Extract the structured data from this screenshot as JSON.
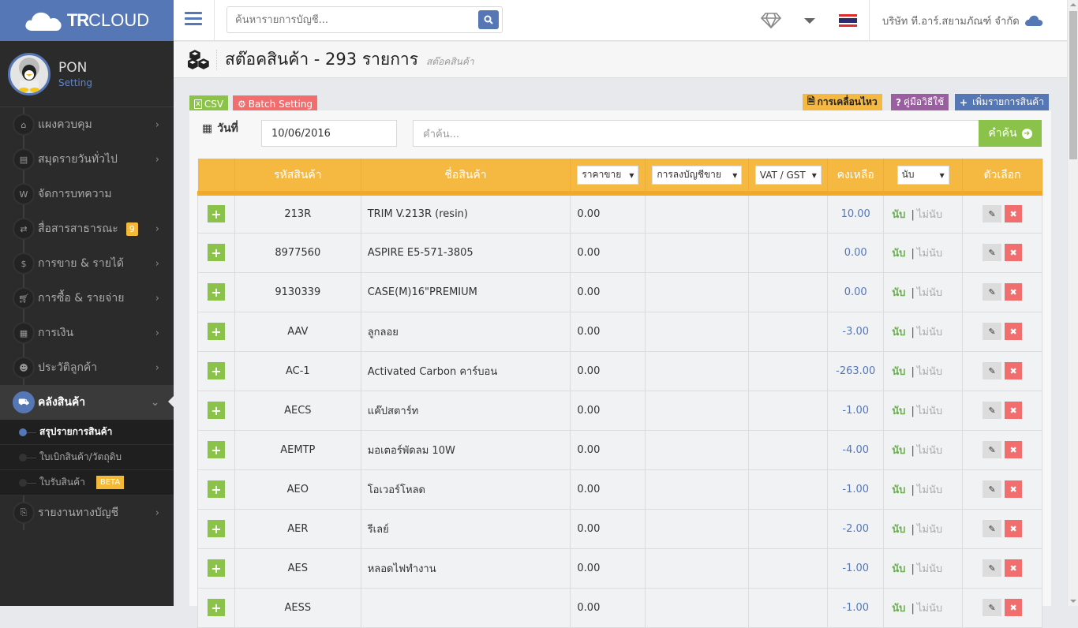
{
  "brand": {
    "bold": "TR",
    "light": "CLOUD"
  },
  "profile": {
    "name": "PON",
    "link": "Setting"
  },
  "sidebar": {
    "items": [
      {
        "label": "แผงควบคุม",
        "icon": "home-icon",
        "glyph": "⌂"
      },
      {
        "label": "สมุดรายวันทั่วไป",
        "icon": "book-icon",
        "glyph": "▤"
      },
      {
        "label": "จัดการบทความ",
        "icon": "wordpress-icon",
        "glyph": "W"
      },
      {
        "label": "สื่อสารสาธารณะ",
        "icon": "exchange-icon",
        "glyph": "⇄",
        "badge": "9"
      },
      {
        "label": "การขาย & รายได้",
        "icon": "dollar-icon",
        "glyph": "$"
      },
      {
        "label": "การซื้อ & รายจ่าย",
        "icon": "cart-icon",
        "glyph": "⛟"
      },
      {
        "label": "การเงิน",
        "icon": "calendar-icon",
        "glyph": "▦"
      },
      {
        "label": "ประวัติลูกค้า",
        "icon": "users-icon",
        "glyph": "☻"
      },
      {
        "label": "คลังสินค้า",
        "icon": "truck-icon",
        "glyph": "⛟"
      }
    ],
    "subitems": [
      {
        "label": "สรุปรายการสินค้า"
      },
      {
        "label": "ใบเบิกสินค้า/วัตถุดิบ"
      },
      {
        "label": "ใบรับสินค้า",
        "badge": "BETA"
      }
    ],
    "last": {
      "label": "รายงานทางบัญชี",
      "icon": "report-icon",
      "glyph": "⎘"
    }
  },
  "topbar": {
    "search_placeholder": "ค้นหารายการบัญชี...",
    "company": "บริษัท ที.อาร์.สยามภัณฑ์ จำกัด"
  },
  "page": {
    "title": "สต๊อคสินค้า - 293 รายการ",
    "subtitle": "สต๊อคสินค้า"
  },
  "toolbar": {
    "csv": "CSV",
    "batch": "Batch Setting",
    "movement": "การเคลื่อนไหว",
    "manual": "คู่มือวิธีใช้",
    "add": "เพิ่มรายการสินค้า"
  },
  "filter": {
    "date_label": "วันที่",
    "date_value": "10/06/2016",
    "query_placeholder": "คำค้น...",
    "search_button": "คำค้น"
  },
  "colors": {
    "primary": "#5577b5",
    "green": "#8bc34a",
    "orange": "#f5b942",
    "red": "#f06e6e",
    "purple": "#9b5ea0"
  },
  "table": {
    "headers": {
      "code": "รหัสสินค้า",
      "name": "ชื่อสินค้า",
      "price": "ราคาขาย",
      "account": "การลงบัญชีขาย",
      "vat": "VAT / GST",
      "balance": "คงเหลือ",
      "count": "นับ",
      "options": "ตัวเลือก"
    },
    "count_label": "นับ",
    "nocount_label": "ไม่นับ",
    "rows": [
      {
        "code": "213R",
        "name": "TRIM V.213R (resin)",
        "price": "0.00",
        "balance": "10.00"
      },
      {
        "code": "8977560",
        "name": "ASPIRE E5-571-3805",
        "price": "0.00",
        "balance": "0.00"
      },
      {
        "code": "9130339",
        "name": "CASE(M)16\"PREMIUM",
        "price": "0.00",
        "balance": "0.00"
      },
      {
        "code": "AAV",
        "name": "ลูกลอย",
        "price": "0.00",
        "balance": "-3.00"
      },
      {
        "code": "AC-1",
        "name": "Activated Carbon คาร์บอน",
        "price": "0.00",
        "balance": "-263.00"
      },
      {
        "code": "AECS",
        "name": "แค๊ปสตาร์ท",
        "price": "0.00",
        "balance": "-1.00"
      },
      {
        "code": "AEMTP",
        "name": "มอเตอร์พัดลม 10W",
        "price": "0.00",
        "balance": "-4.00"
      },
      {
        "code": "AEO",
        "name": "โอเวอร์โหลด",
        "price": "0.00",
        "balance": "-1.00"
      },
      {
        "code": "AER",
        "name": "รีเลย์",
        "price": "0.00",
        "balance": "-2.00"
      },
      {
        "code": "AES",
        "name": "หลอดไฟทำงาน",
        "price": "0.00",
        "balance": "-1.00"
      },
      {
        "code": "AESS",
        "name": "",
        "price": "0.00",
        "balance": "-1.00"
      }
    ]
  }
}
